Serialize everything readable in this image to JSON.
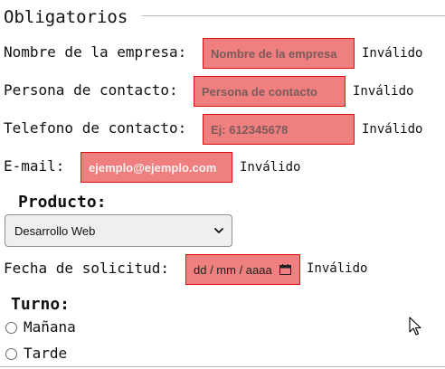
{
  "form": {
    "legend": "Obligatorios",
    "invalid_text": "Inválido",
    "company": {
      "label": "Nombre de la empresa:",
      "value": "Nombre de la empresa"
    },
    "contact": {
      "label": "Persona de contacto:",
      "value": "Persona de contacto"
    },
    "phone": {
      "label": "Telefono de contacto:",
      "value": "Ej: 612345678"
    },
    "email": {
      "label": "E-mail:",
      "value": "ejemplo@ejemplo.com"
    },
    "product": {
      "heading": "Producto:",
      "selected": "Desarrollo Web"
    },
    "date": {
      "label": "Fecha de solicitud:",
      "value": "dd / mm / aaaa"
    },
    "shift": {
      "heading": "Turno:",
      "options": [
        "Mañana",
        "Tarde"
      ]
    }
  },
  "colors": {
    "invalid_bg": "#f08080",
    "invalid_border": "#e01010",
    "fieldset_border": "#b8b8b8"
  },
  "icons": {
    "date": "calendar-icon",
    "select": "chevron-down-icon",
    "pointer": "mouse-cursor-icon"
  }
}
